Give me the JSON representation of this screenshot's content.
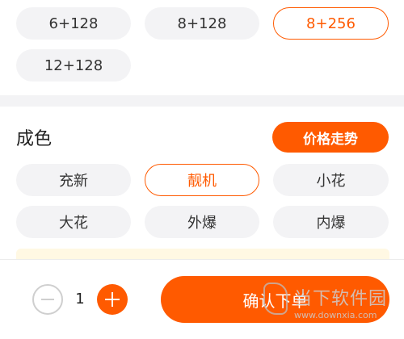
{
  "spec_options": [
    {
      "label": "6+128",
      "selected": false
    },
    {
      "label": "8+128",
      "selected": false
    },
    {
      "label": "8+256",
      "selected": true
    },
    {
      "label": "12+128",
      "selected": false
    }
  ],
  "condition": {
    "title": "成色",
    "trend_button": "价格走势",
    "options": [
      {
        "label": "充新",
        "selected": false
      },
      {
        "label": "靓机",
        "selected": true
      },
      {
        "label": "小花",
        "selected": false
      },
      {
        "label": "大花",
        "selected": false
      },
      {
        "label": "外爆",
        "selected": false
      },
      {
        "label": "内爆",
        "selected": false
      }
    ]
  },
  "bottom_bar": {
    "quantity": "1",
    "confirm_label": "确认下单"
  },
  "watermark": {
    "text": "当下软件园",
    "url": "www.downxia.com"
  },
  "colors": {
    "accent": "#ff5a00",
    "pill_bg": "#f3f3f5",
    "notice_bg": "#fff8e3"
  }
}
